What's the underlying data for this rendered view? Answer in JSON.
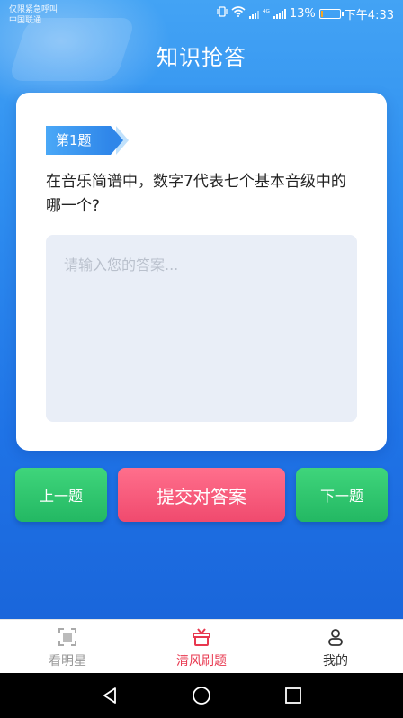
{
  "status_bar": {
    "carrier_line1": "仅限紧急呼叫",
    "carrier_line2": "中国联通",
    "network": "⁴ᴳ",
    "battery": "13%",
    "time": "下午4:33"
  },
  "page_title": "知识抢答",
  "question": {
    "badge": "第1题",
    "text": "在音乐简谱中，数字7代表七个基本音级中的哪一个?",
    "answer_placeholder": "请输入您的答案..."
  },
  "buttons": {
    "prev": "上一题",
    "submit": "提交对答案",
    "next": "下一题"
  },
  "tabs": [
    {
      "label": "看明星",
      "icon": "scan-icon",
      "active": false
    },
    {
      "label": "清风刷题",
      "icon": "gift-icon",
      "active": true
    },
    {
      "label": "我的",
      "icon": "user-icon",
      "active": false
    }
  ],
  "colors": {
    "accent_blue": "#2f8ff0",
    "green_button": "#23b863",
    "pink_button": "#f04a6e",
    "active_tab": "#e8384f"
  }
}
